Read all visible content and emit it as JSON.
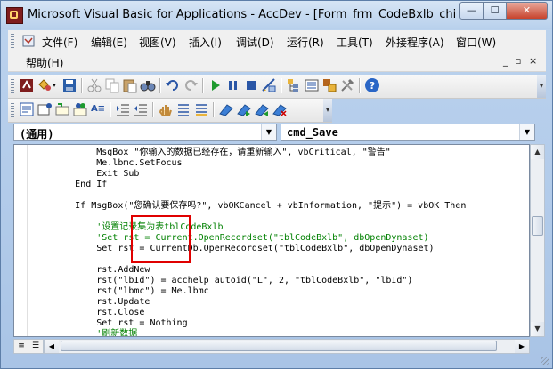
{
  "window": {
    "title": "Microsoft Visual Basic for Applications - AccDev - [Form_frm_CodeBxlb_child_Ad",
    "minimize": "—",
    "maximize": "☐",
    "close": "✕"
  },
  "menu": {
    "items": [
      "文件(F)",
      "编辑(E)",
      "视图(V)",
      "插入(I)",
      "调试(D)",
      "运行(R)",
      "工具(T)",
      "外接程序(A)",
      "窗口(W)"
    ],
    "help": "帮助(H)",
    "mdi_minimize": "_",
    "mdi_restore": "▫",
    "mdi_close": "×"
  },
  "toolbar1": {
    "icons": [
      "view-access-icon",
      "insert-module-icon",
      "save-icon",
      "cut-icon",
      "copy-icon",
      "paste-icon",
      "find-icon",
      "undo-icon",
      "redo-icon",
      "run-icon",
      "break-icon",
      "reset-icon",
      "design-mode-icon",
      "project-explorer-icon",
      "properties-window-icon",
      "object-browser-icon",
      "toolbox-icon",
      "help-icon"
    ]
  },
  "toolbar2": {
    "icons": [
      "list-properties-icon",
      "list-constants-icon",
      "quick-info-icon",
      "parameter-info-icon",
      "complete-word-icon",
      "indent-icon",
      "outdent-icon",
      "toggle-breakpoint-icon",
      "comment-block-icon",
      "uncomment-block-icon",
      "toggle-bookmark-icon",
      "next-bookmark-icon",
      "previous-bookmark-icon",
      "clear-bookmarks-icon"
    ]
  },
  "object_combo": {
    "value": "(通用)"
  },
  "procedure_combo": {
    "value": "cmd_Save"
  },
  "code": {
    "lines": [
      {
        "text": "            MsgBox \"你输入的数据已经存在，请重新输入\", vbCritical, \"警告\"",
        "comment": false
      },
      {
        "text": "            Me.lbmc.SetFocus",
        "comment": false
      },
      {
        "text": "            Exit Sub",
        "comment": false
      },
      {
        "text": "        End If",
        "comment": false
      },
      {
        "text": "",
        "comment": false
      },
      {
        "text": "        If MsgBox(\"您确认要保存吗?\", vbOKCancel + vbInformation, \"提示\") = vbOK Then",
        "comment": false
      },
      {
        "text": "",
        "comment": false
      },
      {
        "text": "            '设置记录集为表tblCodeBxlb",
        "comment": true
      },
      {
        "text": "            'Set rst = Current.OpenRecordset(\"tblCodeBxlb\", dbOpenDynaset)",
        "comment": true
      },
      {
        "text": "            Set rst = CurrentDb.OpenRecordset(\"tblCodeBxlb\", dbOpenDynaset)",
        "comment": false
      },
      {
        "text": "",
        "comment": false
      },
      {
        "text": "            rst.AddNew",
        "comment": false
      },
      {
        "text": "            rst(\"lbId\") = acchelp_autoid(\"L\", 2, \"tblCodeBxlb\", \"lbId\")",
        "comment": false
      },
      {
        "text": "            rst(\"lbmc\") = Me.lbmc",
        "comment": false
      },
      {
        "text": "            rst.Update",
        "comment": false
      },
      {
        "text": "            rst.Close",
        "comment": false
      },
      {
        "text": "            Set rst = Nothing",
        "comment": false
      },
      {
        "text": "            '刷新数据",
        "comment": true
      }
    ]
  },
  "colors": {
    "comment": "#008000",
    "highlight": "#e00000"
  }
}
